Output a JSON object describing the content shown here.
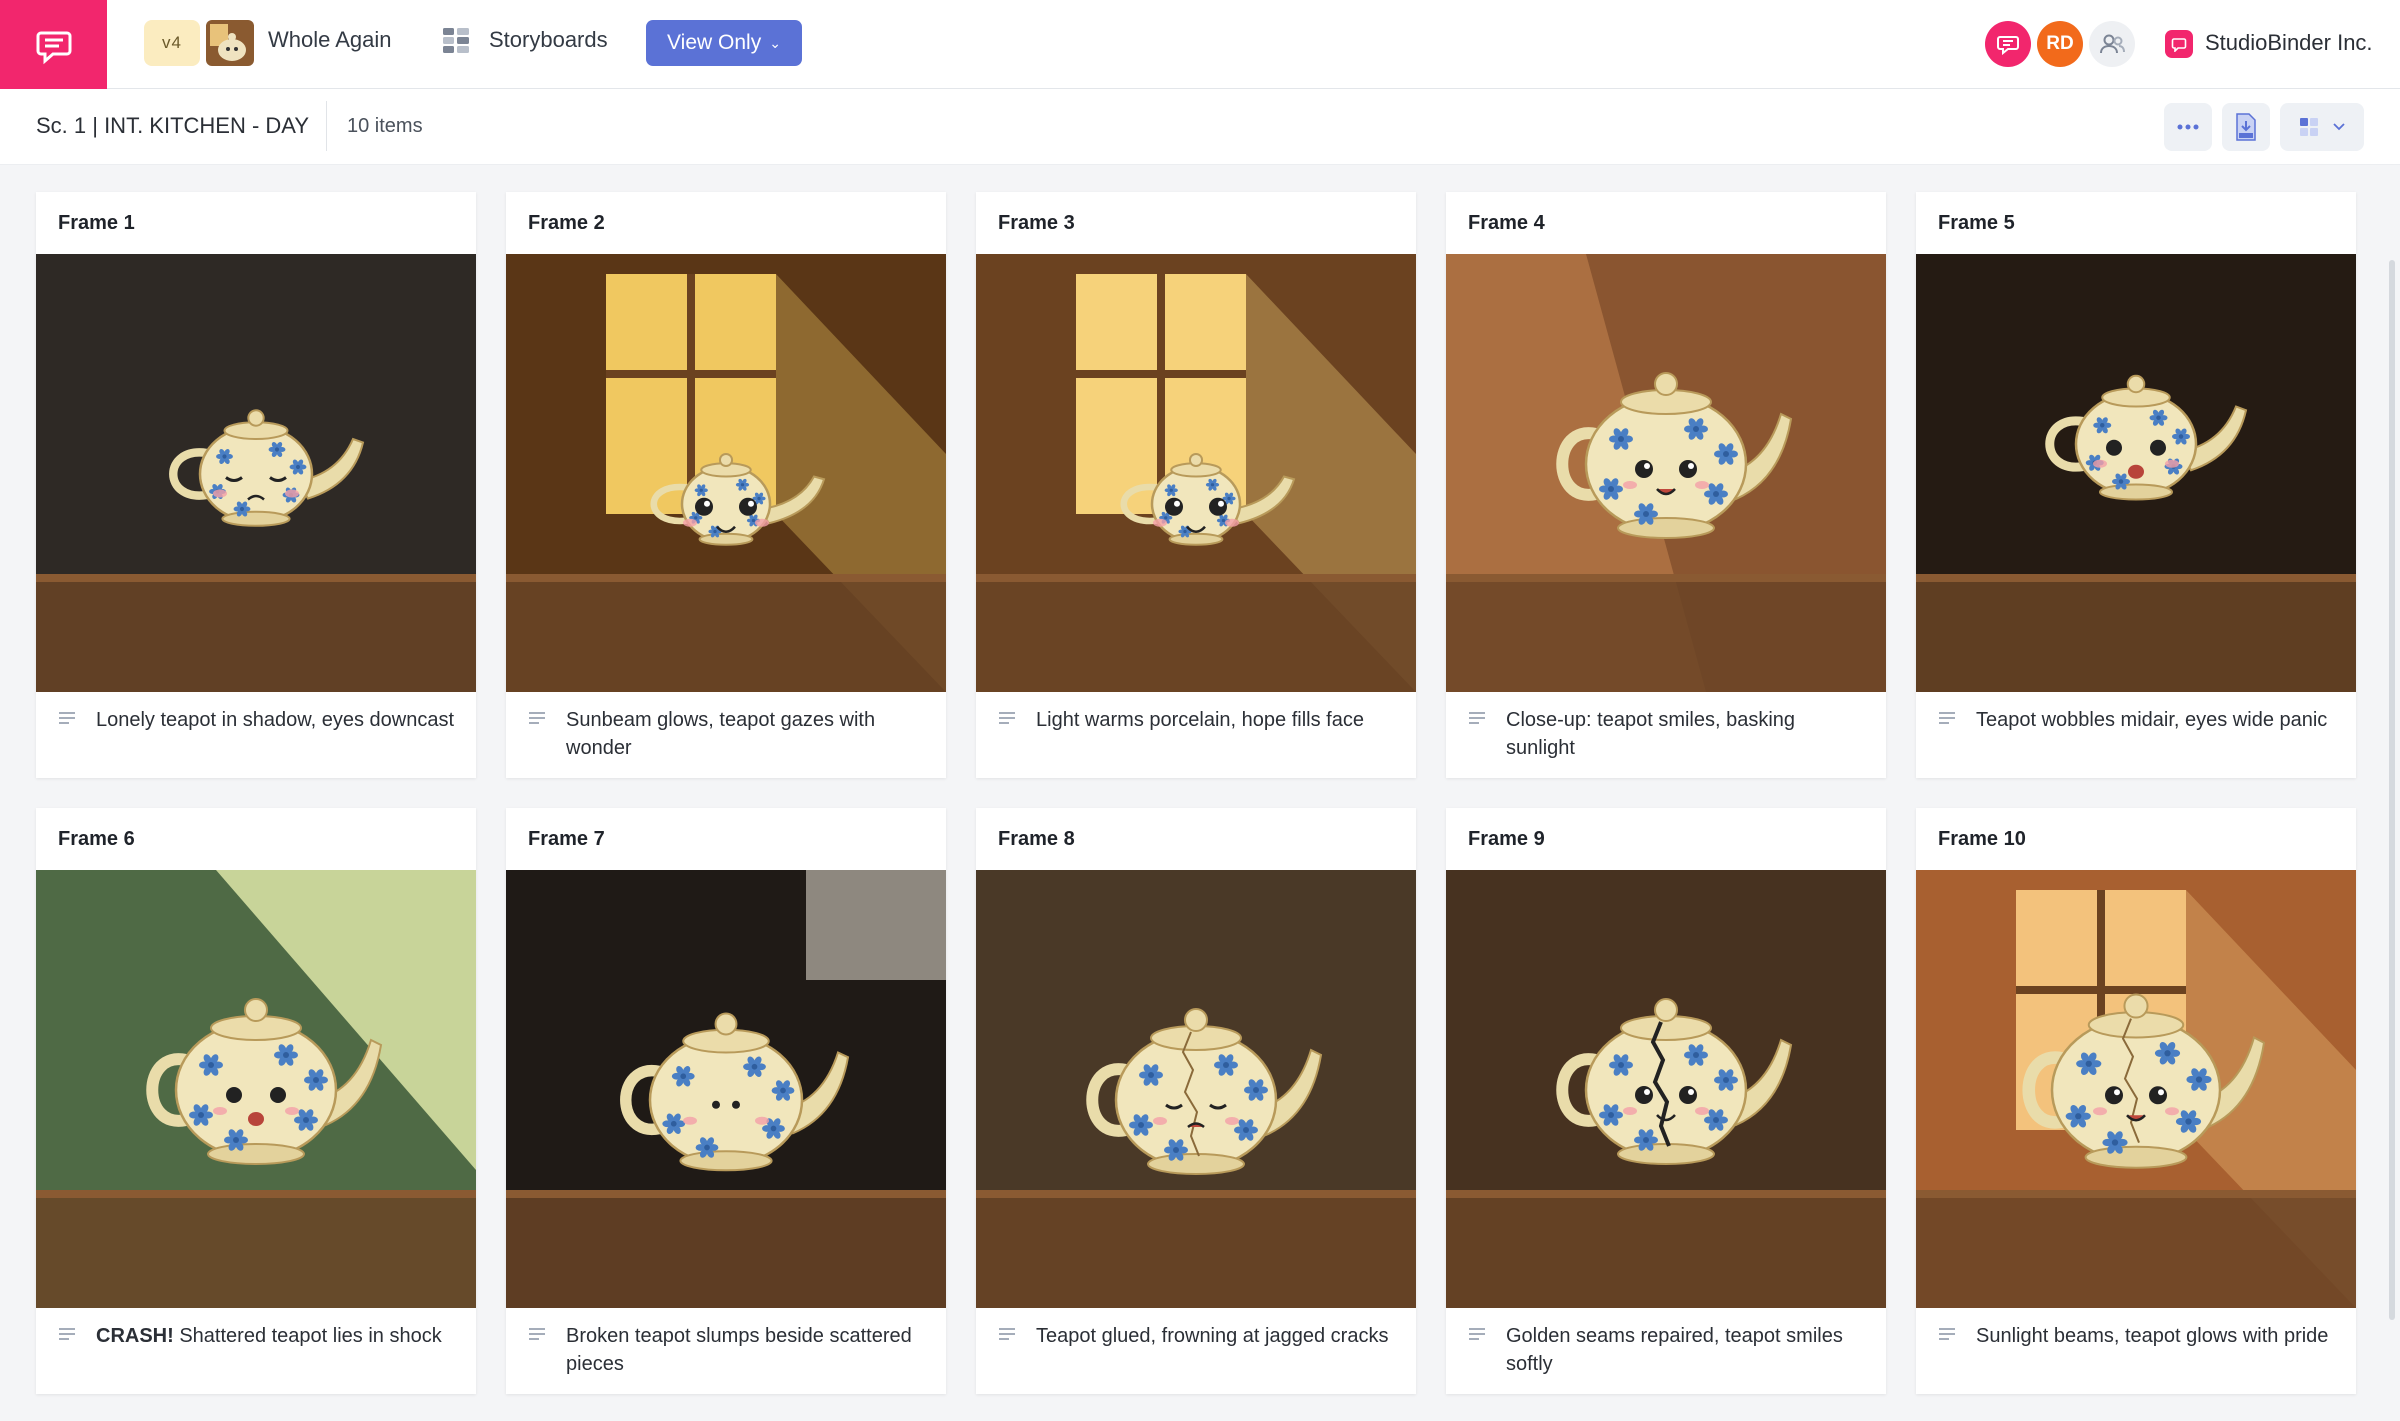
{
  "header": {
    "version": "v4",
    "project_title": "Whole Again",
    "storyboards_label": "Storyboards",
    "view_mode": "View Only",
    "avatars": [
      {
        "initials": "",
        "icon": "chat-bubble-icon",
        "color": "#f2266d"
      },
      {
        "initials": "RD",
        "color": "#f26a1b"
      },
      {
        "initials": "",
        "icon": "people-icon",
        "color": "#eef0f3"
      }
    ],
    "org_name": "StudioBinder Inc.",
    "brand_color": "#f2266d",
    "accent_color": "#5b72d6"
  },
  "subheader": {
    "scene_title": "Sc. 1 | INT. KITCHEN - DAY",
    "items_count": "10 items",
    "tools": [
      "more-icon",
      "pdf-export-icon",
      "grid-layout-icon"
    ]
  },
  "frames": [
    {
      "label": "Frame  1",
      "description": "Lonely teapot in shadow, eyes downcast",
      "bg": "#2a2622",
      "light": "#3a3530",
      "mood": "sad"
    },
    {
      "label": "Frame  2",
      "description": "Sunbeam glows, teapot gazes with wonder",
      "bg": "#5a3616",
      "light": "#f0c860",
      "mood": "wonder"
    },
    {
      "label": "Frame  3",
      "description": "Light warms porcelain, hope fills face",
      "bg": "#6b4220",
      "light": "#f6d27a",
      "mood": "hope"
    },
    {
      "label": "Frame  4",
      "description": "Close-up: teapot smiles, basking sunlight",
      "bg": "#8a5530",
      "light": "#e8a060",
      "mood": "happy"
    },
    {
      "label": "Frame  5",
      "description": "Teapot wobbles midair, eyes wide panic",
      "bg": "#1e1610",
      "light": "#3a2a1c",
      "mood": "panic"
    },
    {
      "label": "Frame  6",
      "description_bold": "CRASH!",
      "description": " Shattered teapot lies in shock",
      "bg": "#4f6a45",
      "light": "#dde6a8",
      "mood": "shock"
    },
    {
      "label": "Frame  7",
      "description": "Broken teapot slumps beside scattered pieces",
      "bg": "#1f1a16",
      "light": "#4a3e34",
      "mood": "broken"
    },
    {
      "label": "Frame  8",
      "description": "Teapot glued, frowning at jagged cracks",
      "bg": "#3a2e22",
      "light": "#7a5a38",
      "mood": "frown"
    },
    {
      "label": "Frame  9",
      "description": "Golden seams repaired, teapot smiles softly",
      "bg": "#3b2a1c",
      "light": "#6b4a2c",
      "mood": "soft"
    },
    {
      "label": "Frame  10",
      "description": "Sunlight beams, teapot glows with pride",
      "bg": "#a86030",
      "light": "#f3c27c",
      "mood": "pride"
    }
  ]
}
